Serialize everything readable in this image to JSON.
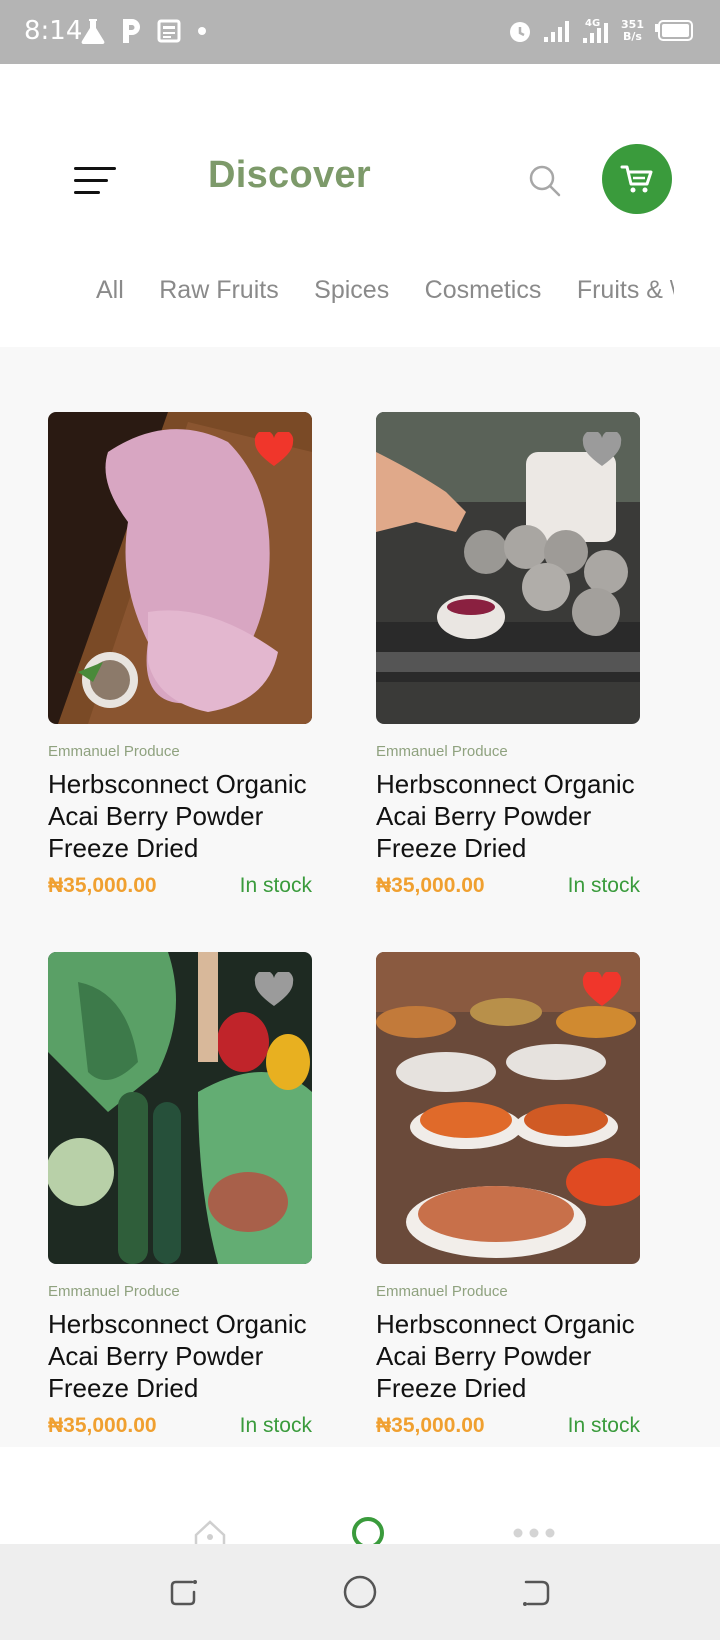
{
  "status_bar": {
    "time": "8:14",
    "left_icons": [
      "flask-icon",
      "parking-icon",
      "news-icon",
      "dot-icon"
    ],
    "right_icons": [
      "alarm-icon",
      "signal-icon",
      "signal-4g-icon",
      "battery-icon"
    ],
    "network_speed_value": "351",
    "network_speed_unit": "B/s",
    "network_type": "4G"
  },
  "header": {
    "title": "Discover",
    "menu_icon": "hamburger-menu-icon",
    "search_icon": "search-icon",
    "cart_icon": "cart-icon",
    "accent_color": "#3a9b3c",
    "title_color": "#7d9a6a"
  },
  "categories": [
    "All",
    "Raw Fruits",
    "Spices",
    "Cosmetics",
    "Fruits & \\"
  ],
  "products": [
    {
      "vendor": "Emmanuel Produce",
      "name": "Herbsconnect Organic Acai Berry Powder Freeze Dried",
      "price": "₦35,000.00",
      "stock": "In stock",
      "favorite": true,
      "image": "raw-meat-photo"
    },
    {
      "vendor": "Emmanuel Produce",
      "name": "Herbsconnect Organic Acai Berry Powder Freeze Dried",
      "price": "₦35,000.00",
      "stock": "In stock",
      "favorite": false,
      "image": "dessert-tray-photo"
    },
    {
      "vendor": "Emmanuel Produce",
      "name": "Herbsconnect Organic Acai Berry Powder Freeze Dried",
      "price": "₦35,000.00",
      "stock": "In stock",
      "favorite": false,
      "image": "vegetables-in-bags-photo"
    },
    {
      "vendor": "Emmanuel Produce",
      "name": "Herbsconnect Organic Acai Berry Powder Freeze Dried",
      "price": "₦35,000.00",
      "stock": "In stock",
      "favorite": true,
      "image": "spice-market-photo"
    }
  ],
  "bottom_nav": [
    "home-icon",
    "circle-icon",
    "more-dots-icon"
  ],
  "system_nav": [
    "recent-apps-icon",
    "home-circle-icon",
    "back-icon"
  ]
}
